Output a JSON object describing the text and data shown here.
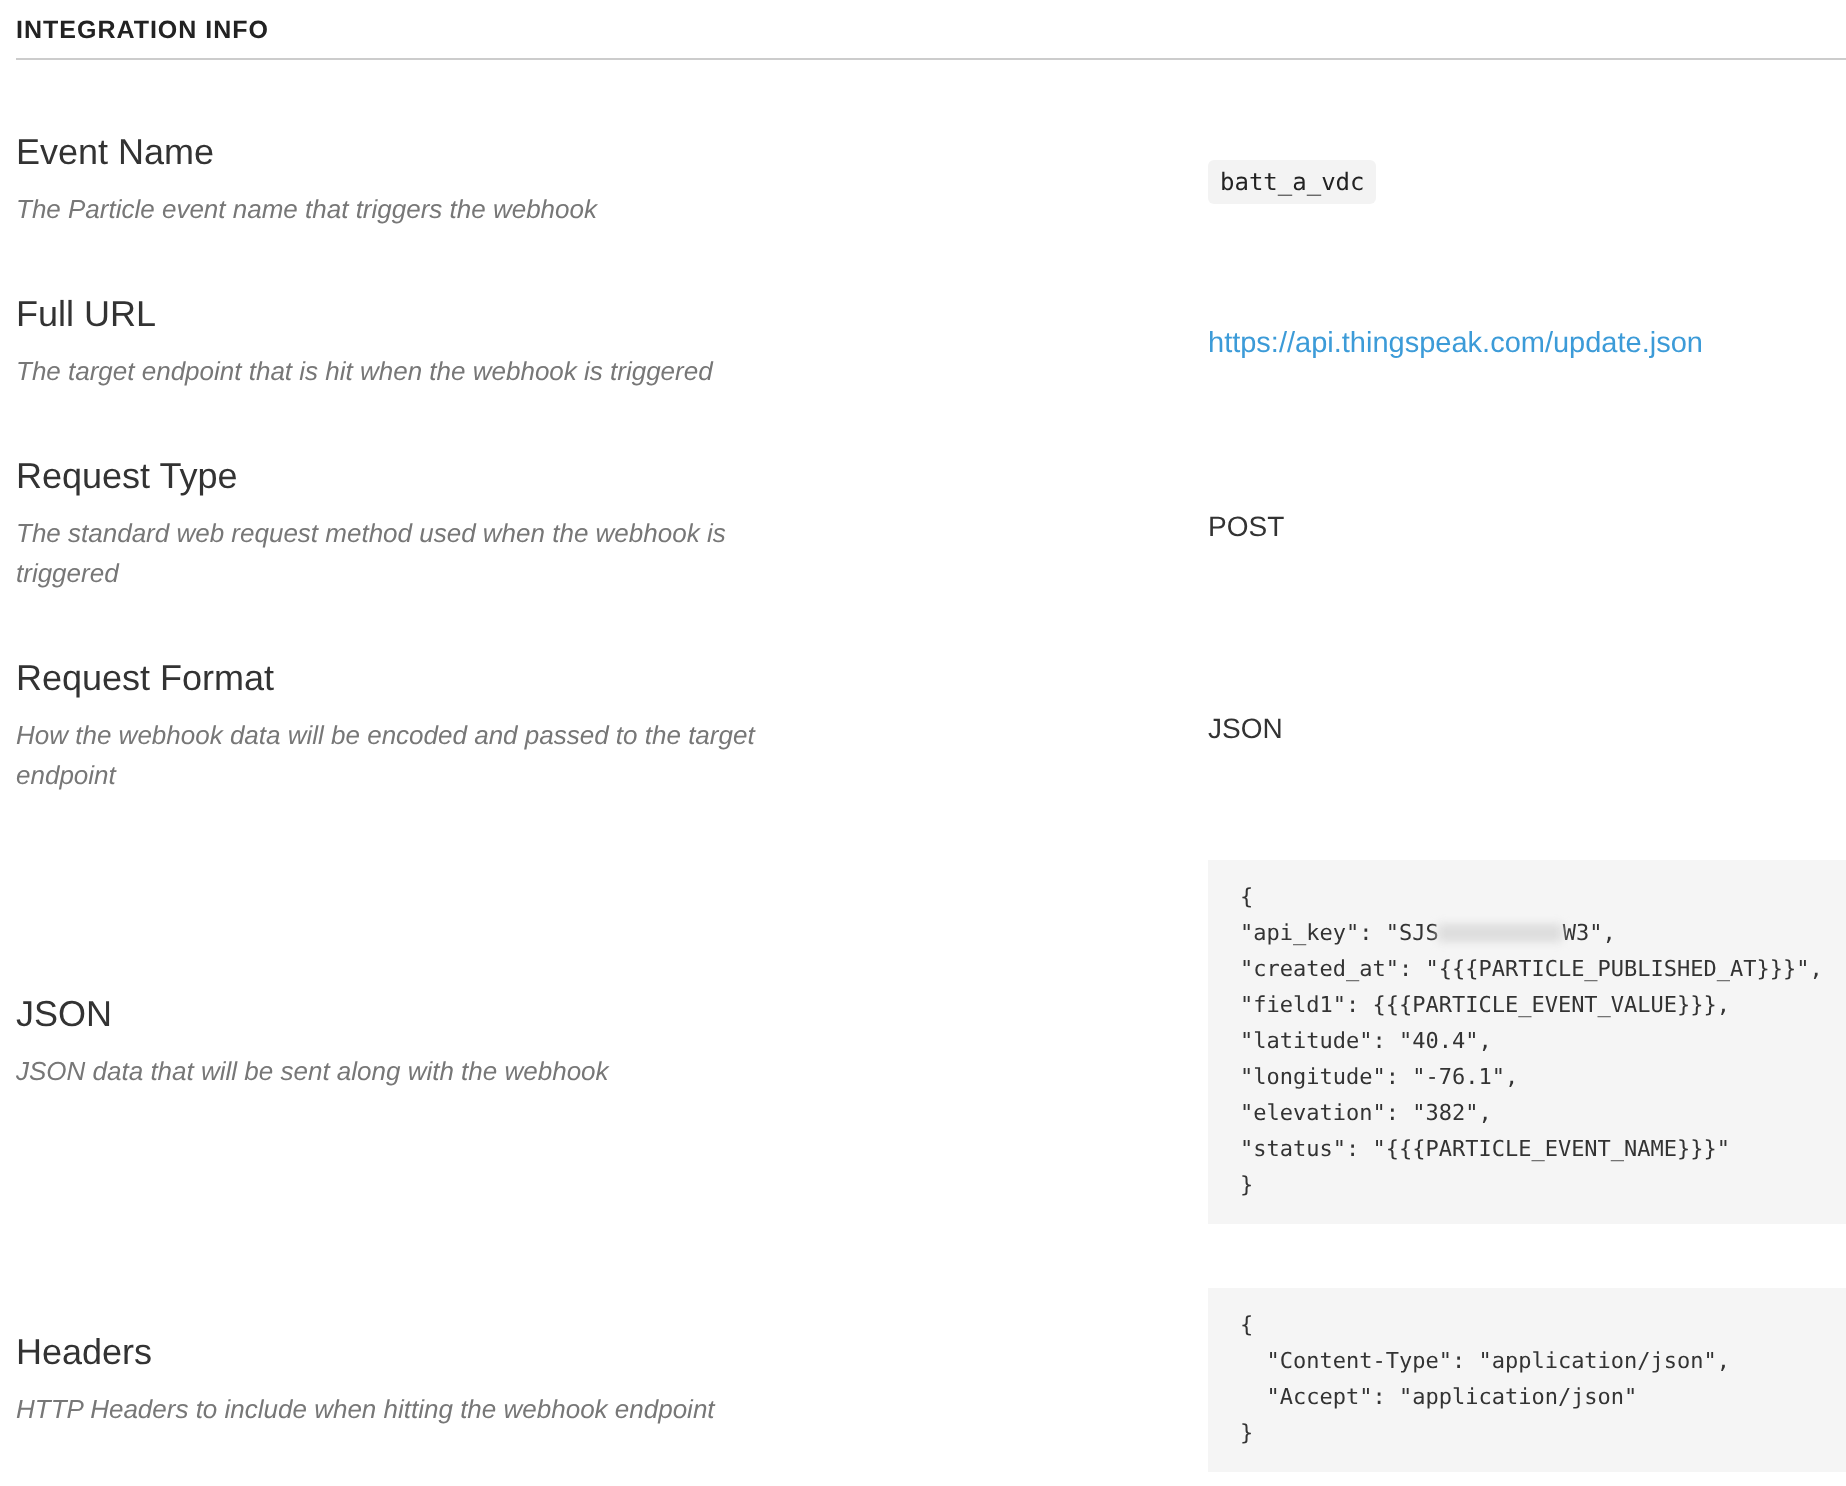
{
  "section_title": "INTEGRATION INFO",
  "rows": [
    {
      "label": "Event Name",
      "description": "The Particle event name that triggers the webhook",
      "value": {
        "kind": "code",
        "text": "batt_a_vdc"
      }
    },
    {
      "label": "Full URL",
      "description": "The target endpoint that is hit when the webhook is triggered",
      "value": {
        "kind": "link",
        "text": "https://api.thingspeak.com/update.json"
      }
    },
    {
      "label": "Request Type",
      "description": "The standard web request method used when the webhook is triggered",
      "value": {
        "kind": "text",
        "text": "POST"
      }
    },
    {
      "label": "Request Format",
      "description": "How the webhook data will be encoded and passed to the target endpoint",
      "value": {
        "kind": "text",
        "text": "JSON"
      }
    },
    {
      "label": "JSON",
      "description": "JSON data that will be sent along with the webhook",
      "value": {
        "kind": "block",
        "lines": [
          {
            "kind": "text",
            "text": "{"
          },
          {
            "kind": "redacted",
            "before": "\"api_key\": \"SJS",
            "after": "W3\","
          },
          {
            "kind": "text",
            "text": "\"created_at\": \"{{{PARTICLE_PUBLISHED_AT}}}\","
          },
          {
            "kind": "text",
            "text": "\"field1\": {{{PARTICLE_EVENT_VALUE}}},"
          },
          {
            "kind": "text",
            "text": "\"latitude\": \"40.4\","
          },
          {
            "kind": "text",
            "text": "\"longitude\": \"-76.1\","
          },
          {
            "kind": "text",
            "text": "\"elevation\": \"382\","
          },
          {
            "kind": "text",
            "text": "\"status\": \"{{{PARTICLE_EVENT_NAME}}}\""
          },
          {
            "kind": "text",
            "text": "}"
          }
        ]
      }
    },
    {
      "label": "Headers",
      "description": "HTTP Headers to include when hitting the webhook endpoint",
      "value": {
        "kind": "block",
        "lines": [
          {
            "kind": "text",
            "text": "{"
          },
          {
            "kind": "text",
            "text": "  \"Content-Type\": \"application/json\","
          },
          {
            "kind": "text",
            "text": "  \"Accept\": \"application/json\""
          },
          {
            "kind": "text",
            "text": "}"
          }
        ]
      }
    }
  ]
}
